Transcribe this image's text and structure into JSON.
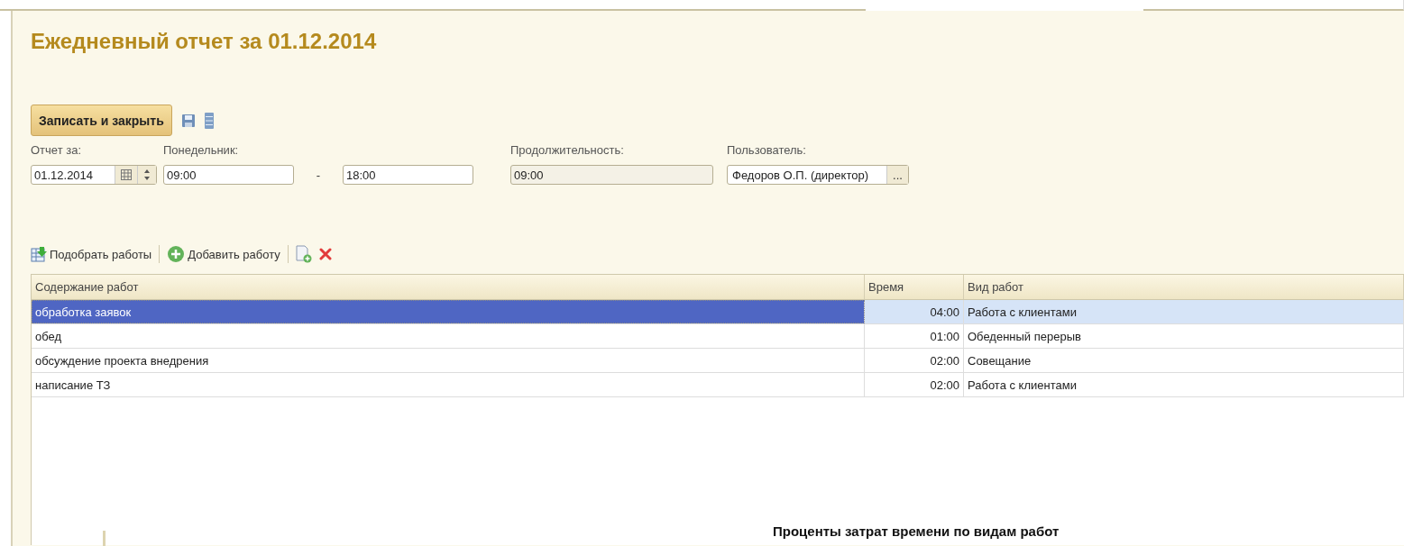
{
  "title": "Ежедневный отчет за 01.12.2014",
  "toolbar": {
    "save_close": "Записать и закрыть"
  },
  "fields": {
    "date": {
      "label": "Отчет за:",
      "value": "01.12.2014"
    },
    "day": {
      "label": "Понедельник:",
      "start": "09:00",
      "separator": "-",
      "end": "18:00"
    },
    "duration": {
      "label": "Продолжительность:",
      "value": "09:00"
    },
    "user": {
      "label": "Пользователь:",
      "value": "Федоров О.П. (директор)",
      "button": "..."
    }
  },
  "table_toolbar": {
    "pick": "Подобрать работы",
    "add": "Добавить работу"
  },
  "table": {
    "columns": [
      "Содержание работ",
      "Время",
      "Вид работ"
    ],
    "rows": [
      {
        "content": "обработка заявок",
        "time": "04:00",
        "kind_of_work": "Работа с клиентами",
        "selected": true
      },
      {
        "content": "обед",
        "time": "01:00",
        "kind_of_work": "Обеденный перерыв",
        "selected": false
      },
      {
        "content": "обсуждение проекта внедрения",
        "time": "02:00",
        "kind_of_work": "Совещание",
        "selected": false
      },
      {
        "content": "написание ТЗ",
        "time": "02:00",
        "kind_of_work": "Работа с клиентами",
        "selected": false
      }
    ]
  },
  "chart_heading": "Проценты затрат времени по видам работ"
}
